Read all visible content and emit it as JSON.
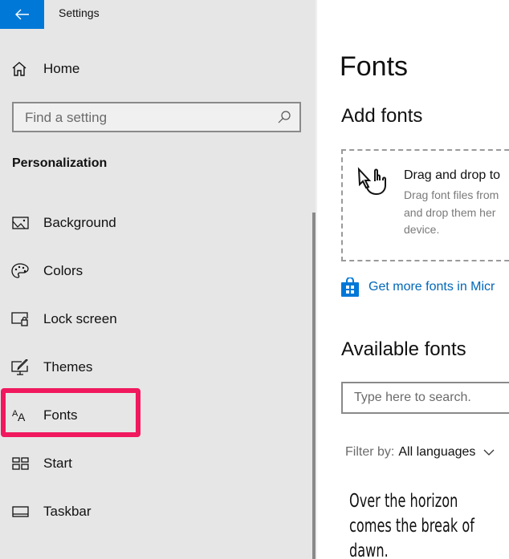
{
  "window": {
    "title": "Settings"
  },
  "colors": {
    "accent": "#0078d7",
    "highlight": "#f0185e",
    "link": "#0067b8",
    "sidebar_bg": "#e6e6e6"
  },
  "sidebar": {
    "back_icon": "arrow-left-icon",
    "home": {
      "label": "Home",
      "icon": "home-icon"
    },
    "search": {
      "placeholder": "Find a setting",
      "value": "",
      "icon": "search-icon"
    },
    "section_title": "Personalization",
    "items": [
      {
        "label": "Background",
        "icon": "picture-icon"
      },
      {
        "label": "Colors",
        "icon": "palette-icon"
      },
      {
        "label": "Lock screen",
        "icon": "lock-screen-icon"
      },
      {
        "label": "Themes",
        "icon": "brush-icon"
      },
      {
        "label": "Fonts",
        "icon": "fonts-icon",
        "selected": true,
        "highlighted": true
      },
      {
        "label": "Start",
        "icon": "start-tiles-icon"
      },
      {
        "label": "Taskbar",
        "icon": "taskbar-icon"
      }
    ]
  },
  "main": {
    "title": "Fonts",
    "add_fonts": {
      "heading": "Add fonts",
      "drop_title": "Drag and drop to",
      "drop_lines": [
        "Drag font files from",
        "and drop them her",
        "device."
      ],
      "icon": "hand-pointer-icon"
    },
    "store_link": {
      "label": "Get more fonts in Micr",
      "icon": "store-bag-icon"
    },
    "available": {
      "heading": "Available fonts",
      "search_placeholder": "Type here to search.",
      "filter_label": "Filter by:",
      "filter_value": "All languages",
      "preview_text": "Over the horizon comes the break of dawn."
    }
  }
}
